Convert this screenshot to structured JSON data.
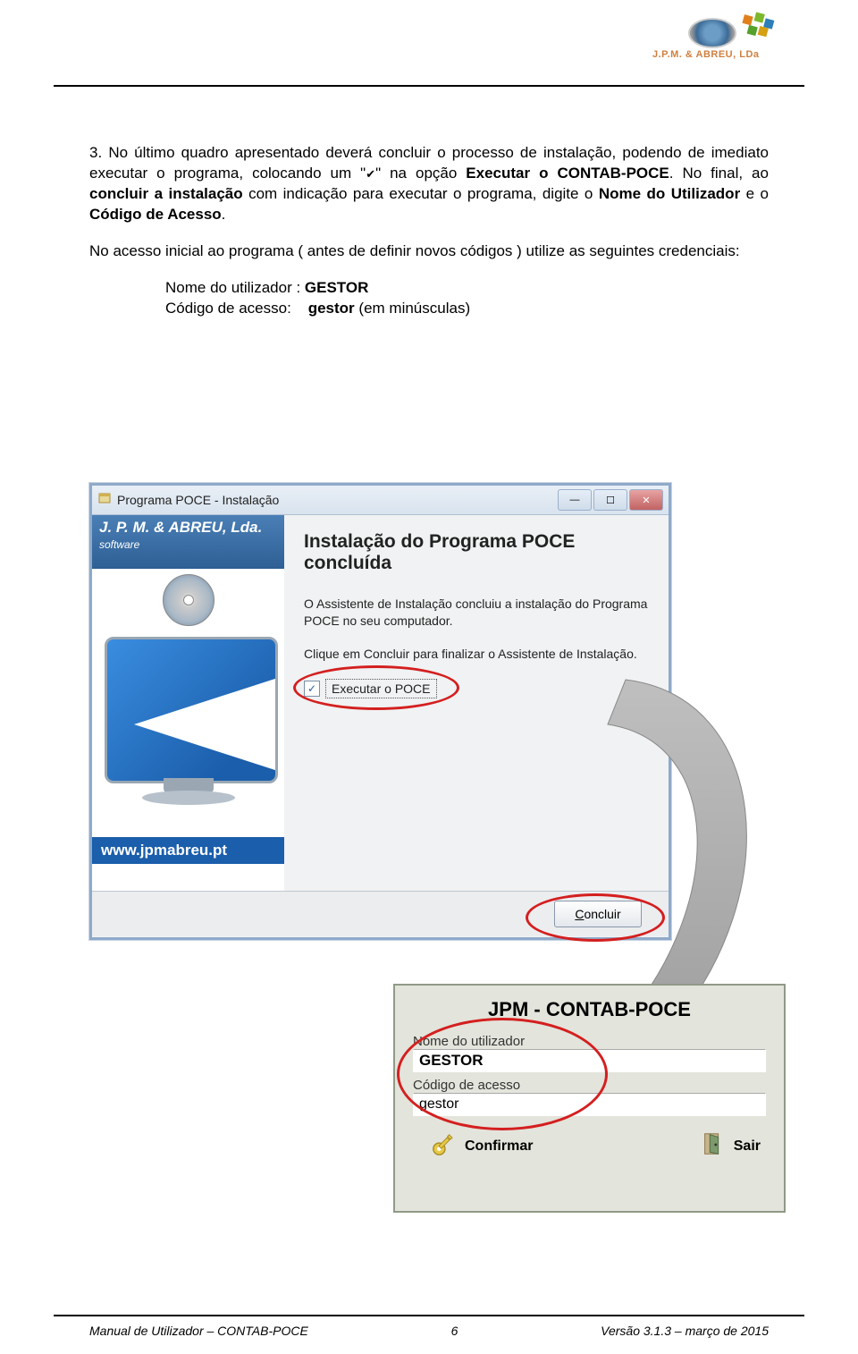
{
  "header": {
    "logo_text": "J.P.M. & ABREU, LDa"
  },
  "body": {
    "para1_prefix": "3. No último quadro apresentado deverá concluir o processo de instalação, podendo de imediato executar o programa, colocando um \"",
    "para1_check": "✔",
    "para1_mid": "\" na opção ",
    "para1_bold1": "Executar o CONTAB-POCE",
    "para1_mid2": ". No final, ao ",
    "para1_bold2": "concluir a instalação",
    "para1_mid3": " com indicação para executar o programa, digite o ",
    "para1_bold3": "Nome do Utilizador",
    "para1_mid4": " e o ",
    "para1_bold4": "Código de Acesso",
    "para1_end": ".",
    "para2": "No acesso inicial ao programa ( antes de definir novos códigos ) utilize as seguintes credenciais:",
    "cred_user_label": "Nome do utilizador : ",
    "cred_user_value": "GESTOR",
    "cred_pass_label": "Código de acesso:    ",
    "cred_pass_value": "gestor",
    "cred_pass_note": " (em minúsculas)"
  },
  "installer": {
    "window_title": "Programa POCE - Instalação",
    "brand": "J. P. M. & ABREU, Lda.",
    "brand_sub": "software",
    "url": "www.jpmabreu.pt",
    "title_line1": "Instalação do Programa POCE",
    "title_line2": "concluída",
    "p1": "O Assistente de Instalação concluiu a instalação do Programa POCE no seu computador.",
    "p2": "Clique em Concluir para finalizar o Assistente de Instalação.",
    "checkbox_label": "Executar o POCE",
    "concluir": "Concluir"
  },
  "login": {
    "title": "JPM - CONTAB-POCE",
    "user_label": "Nome do utilizador",
    "user_value": "GESTOR",
    "pass_label": "Código de acesso",
    "pass_value": "gestor",
    "confirm": "Confirmar",
    "exit": "Sair"
  },
  "footer": {
    "left": "Manual de Utilizador – CONTAB-POCE",
    "center": "6",
    "right": "Versão 3.1.3 – março de 2015"
  }
}
